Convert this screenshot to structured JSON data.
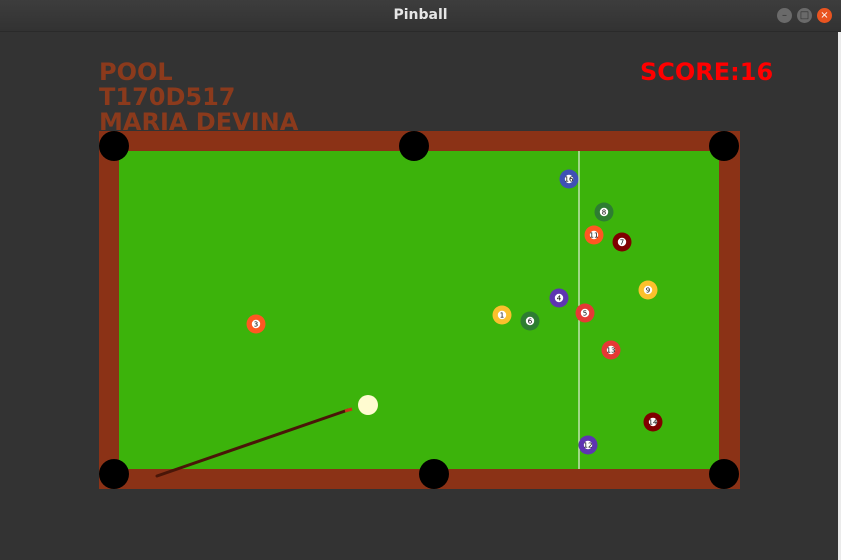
{
  "window": {
    "title": "Pinball",
    "min_glyph": "–",
    "max_glyph": "□",
    "close_glyph": "×"
  },
  "hud": {
    "line1": "POOL",
    "line2": "T170D517",
    "line3": "MARIA DEVINA",
    "score": "SCORE:16",
    "name_color": "#8b3a1c",
    "score_color": "#ff0000"
  },
  "table": {
    "felt_color": "#3cb30b",
    "rail_color": "#8b3216",
    "pocket_color": "#000000",
    "line_color": "#ffffff"
  },
  "balls": [
    {
      "number": "16",
      "color": "#3f51b5"
    },
    {
      "number": "8",
      "color": "#2e7d32"
    },
    {
      "number": "11",
      "color": "#ff5722"
    },
    {
      "number": "7",
      "color": "#7f0000"
    },
    {
      "number": "9",
      "color": "#fbc02d"
    },
    {
      "number": "4",
      "color": "#5e35b1"
    },
    {
      "number": "1",
      "color": "#fbc02d"
    },
    {
      "number": "6",
      "color": "#2e7d32"
    },
    {
      "number": "5",
      "color": "#e53935"
    },
    {
      "number": "3",
      "color": "#ff5722"
    },
    {
      "number": "13",
      "color": "#e53935"
    },
    {
      "number": "14",
      "color": "#7f0000"
    },
    {
      "number": "12",
      "color": "#5e35b1"
    }
  ],
  "cue_ball": {
    "color": "#fffbd0"
  },
  "cue_stick": {
    "color": "#4a1608",
    "tip_color": "#c8341a"
  }
}
